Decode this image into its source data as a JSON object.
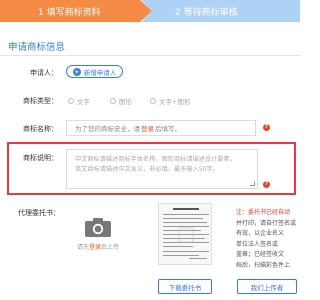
{
  "steps": [
    {
      "label": "1 填写商标资料",
      "state": "active"
    },
    {
      "label": "2 等待商标审核",
      "state": "pending"
    }
  ],
  "colors": {
    "accent": "#3a7bd5",
    "step_active": "#f58a46",
    "step_pending": "#aed2f6",
    "highlight": "#e53b3b"
  },
  "section": {
    "title": "申请商标信息"
  },
  "applicant": {
    "label": "申请人：",
    "add_button": "新增申请人"
  },
  "trademark_type": {
    "label": "商标类型：",
    "options": [
      "文字",
      "图形",
      "文字+图形"
    ]
  },
  "trademark_name": {
    "label": "商标名称：",
    "placeholder_prefix": "为了您的商标安全，请",
    "placeholder_link": "登录",
    "placeholder_suffix": "后填写。"
  },
  "trademark_desc": {
    "label": "商标说明：",
    "placeholder_line1": "中文商标请描述商标字体名称，图形商标请描述设计要素，",
    "placeholder_line2": "英文商标请描述中文含义，非必填，最多输入50字。"
  },
  "power_of_attorney": {
    "label": "代理委托书：",
    "upload_prefix": "请先",
    "upload_link": "登录",
    "upload_suffix": "后上传",
    "download_button": "下载委托书",
    "note_lines": [
      "注：委托书已经自动",
      "并打印，请自行签名或",
      "有效，以企业名义",
      "单位法人签名或",
      "盖章；已经签收文",
      "档后，扫描彩色件上",
      "传件，小于5M。"
    ],
    "upload_button": "我们上传者"
  }
}
